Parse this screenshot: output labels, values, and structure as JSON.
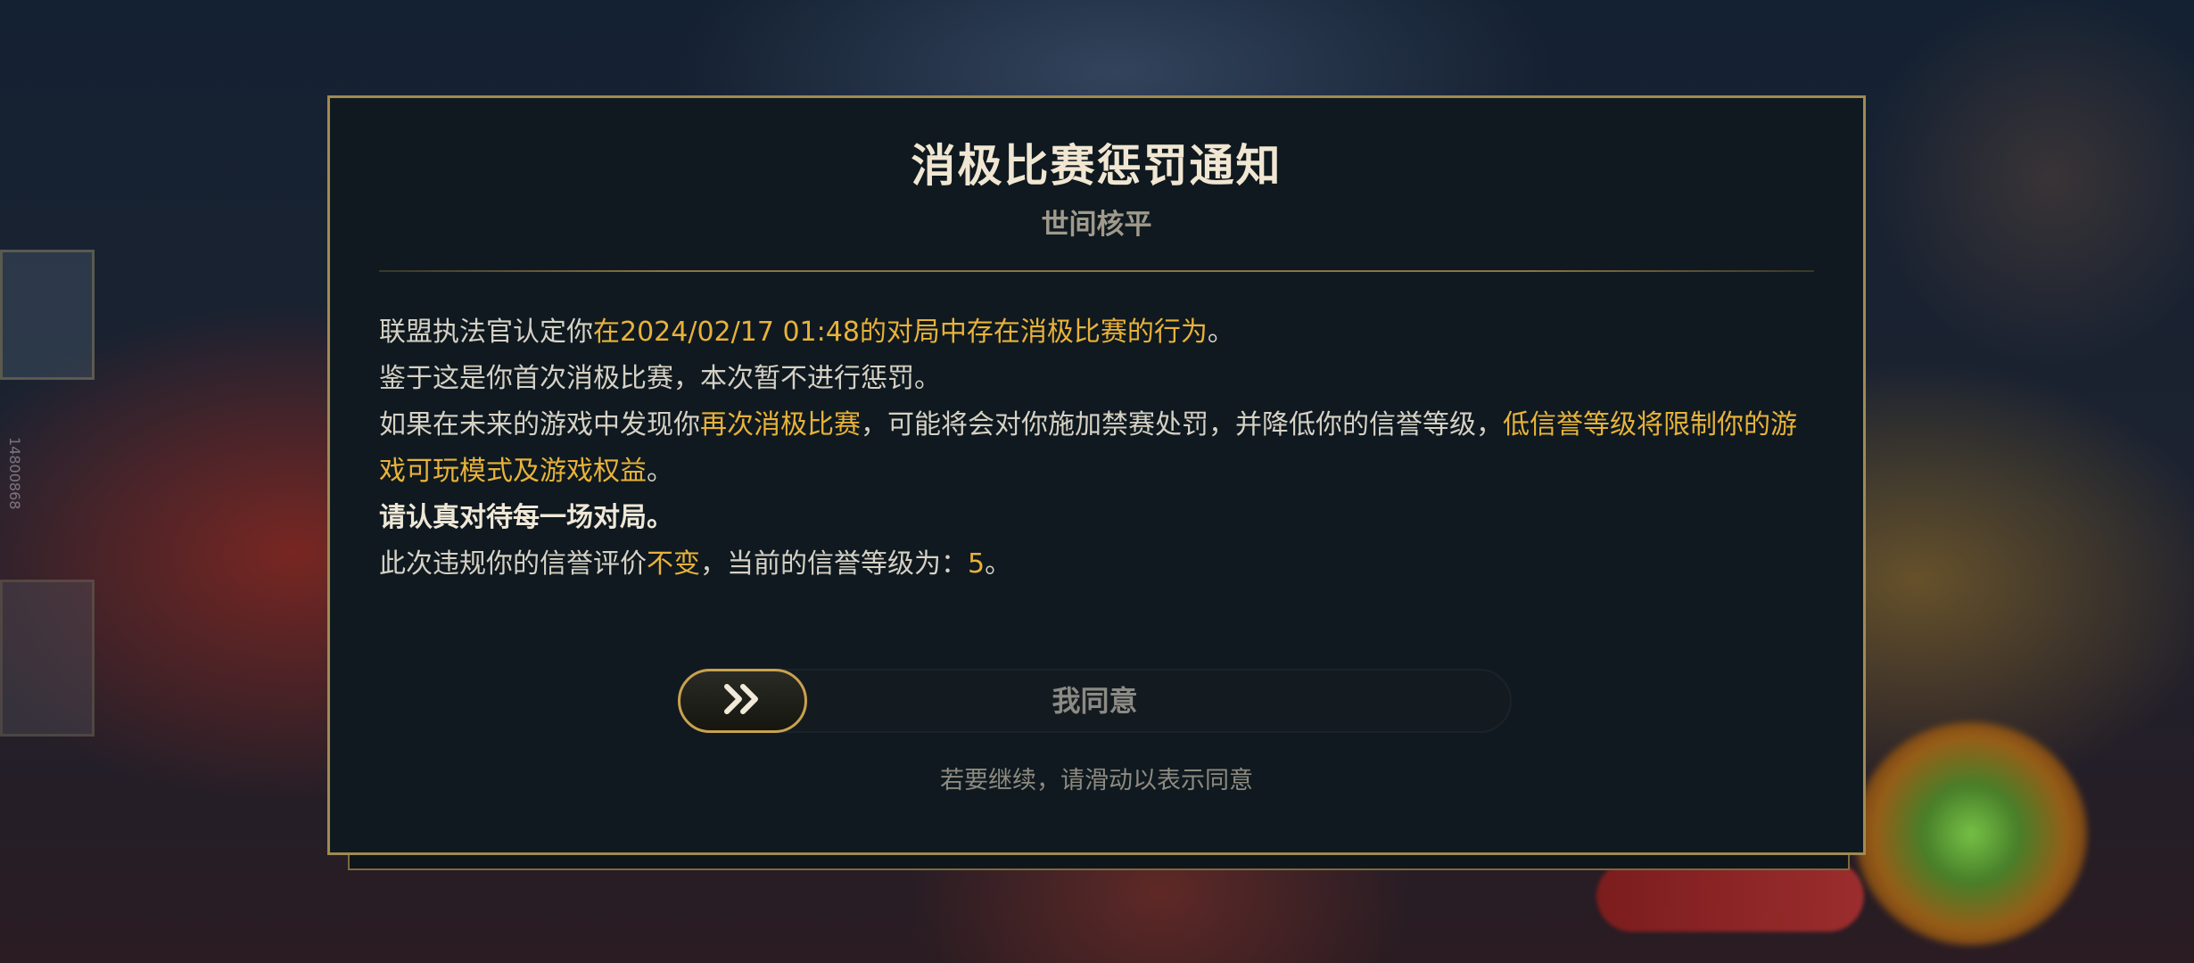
{
  "dialog": {
    "title": "消极比赛惩罚通知",
    "subtitle": "世间核平",
    "body": {
      "line1_a": "联盟执法官认定你",
      "line1_b": "在2024/02/17 01:48的对局中存在消极比赛的行为",
      "line1_c": "。",
      "line2": "鉴于这是你首次消极比赛，本次暂不进行惩罚。",
      "line3_a": "如果在未来的游戏中发现你",
      "line3_b": "再次消极比赛",
      "line3_c": "，可能将会对你施加禁赛处罚，并降低你的信誉等级，",
      "line3_d": "低信誉等级将限制你的游戏可玩模式及游戏权益",
      "line3_e": "。",
      "line4": "请认真对待每一场对局。",
      "line5_a": "此次违规你的信誉评价",
      "line5_b": "不变",
      "line5_c": "，当前的信誉等级为：",
      "line5_d": "5",
      "line5_e": "。"
    },
    "slider": {
      "label": "我同意",
      "knob_icon": "double-chevron-right-icon"
    },
    "hint": "若要继续，请滑动以表示同意"
  },
  "background": {
    "side_text": "14800868"
  },
  "colors": {
    "highlight": "#e8b23a",
    "border_gold": "#a08a52",
    "dialog_bg": "#0f191f",
    "title": "#f0e6d2"
  }
}
